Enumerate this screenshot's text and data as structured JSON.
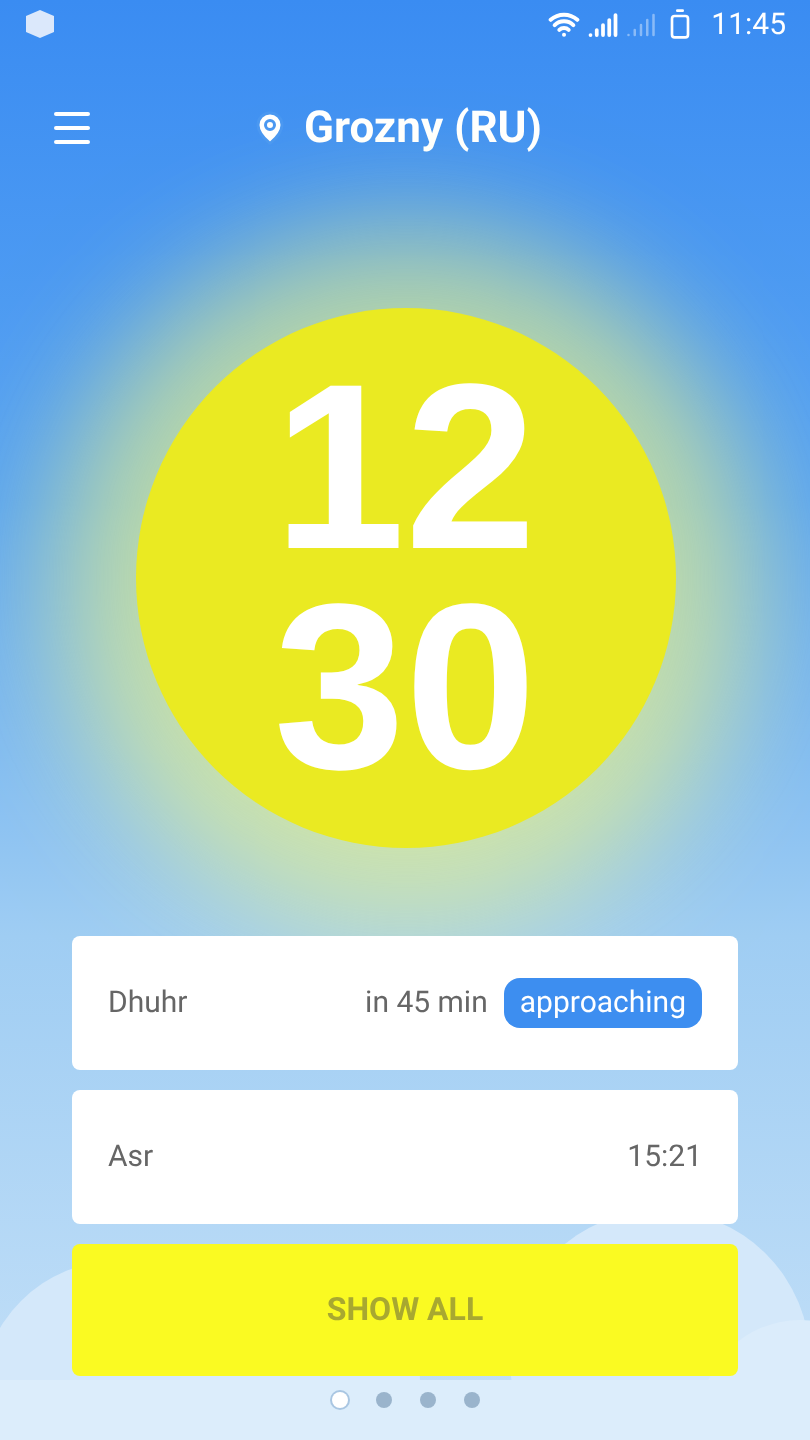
{
  "status_bar": {
    "time": "11:45"
  },
  "header": {
    "location": "Grozny (RU)"
  },
  "clock": {
    "hours": "12",
    "minutes": "30"
  },
  "prayers": [
    {
      "name": "Dhuhr",
      "time": "in 45 min",
      "badge": "approaching"
    },
    {
      "name": "Asr",
      "time": "15:21"
    }
  ],
  "button": "SHOW ALL",
  "pages": [
    {
      "selected": true
    },
    {
      "selected": false
    },
    {
      "selected": false
    },
    {
      "selected": false
    }
  ]
}
